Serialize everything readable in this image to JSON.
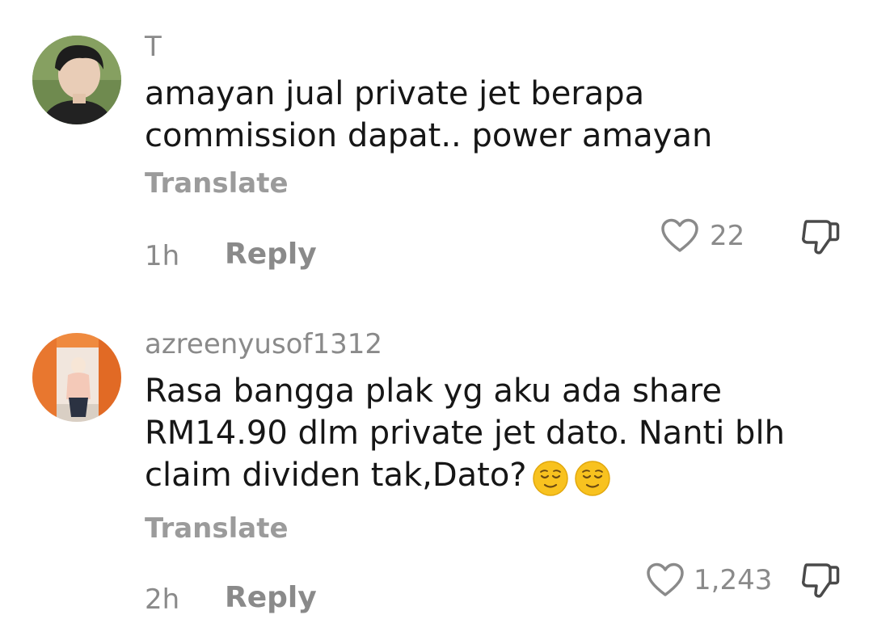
{
  "comments": [
    {
      "avatar_icon": "user-avatar-photo",
      "username": "T",
      "lines": [
        "amayan jual private jet berapa",
        "commission dapat.. power amayan"
      ],
      "translate_label": "Translate",
      "time": "1h",
      "reply_label": "Reply",
      "like_count": "22",
      "like_icon": "heart-outline-icon",
      "dislike_icon": "thumbs-down-icon"
    },
    {
      "avatar_icon": "user-avatar-photo",
      "username": "azreenyusof1312",
      "lines": [
        "Rasa bangga plak yg aku ada share",
        "RM14.90 dlm private jet dato. Nanti blh",
        "claim dividen tak,Dato?"
      ],
      "emoji": [
        "relieved-face-emoji",
        "relieved-face-emoji"
      ],
      "translate_label": "Translate",
      "time": "2h",
      "reply_label": "Reply",
      "like_count": "1,243",
      "like_icon": "heart-outline-icon",
      "dislike_icon": "thumbs-down-icon"
    }
  ],
  "colors": {
    "text_primary": "#161616",
    "text_secondary": "#8a8a8a",
    "background": "#ffffff",
    "emoji_yellow": "#f8c21f"
  }
}
